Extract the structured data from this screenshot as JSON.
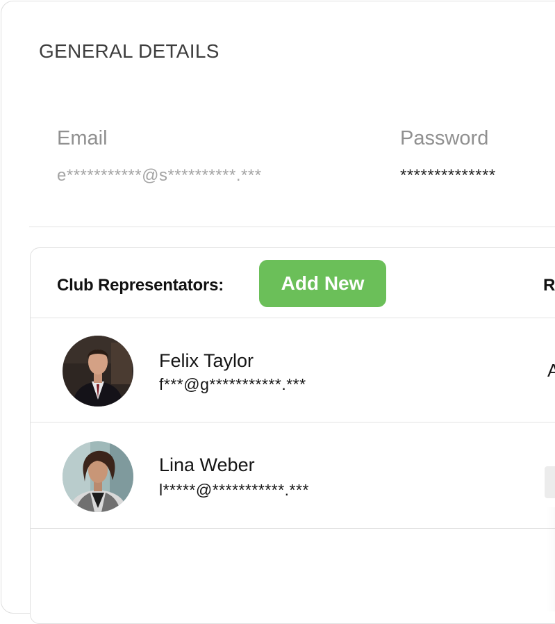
{
  "general_details": {
    "title": "GENERAL DETAILS",
    "email_label": "Email",
    "email_value": "e***********@s**********.***",
    "password_label": "Password",
    "password_value": "**************"
  },
  "club_representators": {
    "title": "Club Representators:",
    "add_button_label": "Add New",
    "column_heading_partial": "R",
    "rows": [
      {
        "name": "Felix Taylor",
        "email": "f***@g***********.***",
        "role_partial": "A"
      },
      {
        "name": "Lina Weber",
        "email": "l*****@***********.***",
        "role_partial": ""
      }
    ]
  },
  "colors": {
    "accent_green": "#6bbf59",
    "muted_text": "#a4a4a4",
    "border": "#e2e2e2"
  }
}
